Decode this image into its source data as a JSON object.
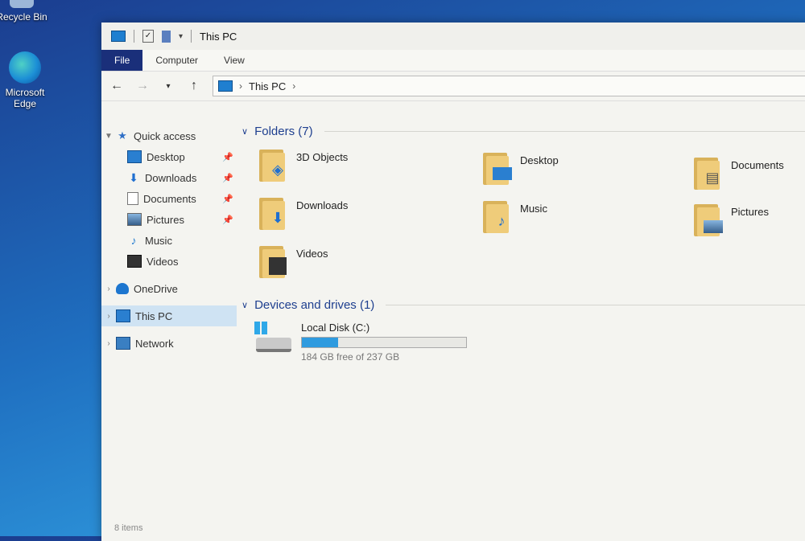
{
  "desktop": {
    "recycle_label": "Recycle Bin",
    "edge_label": "Microsoft Edge"
  },
  "window": {
    "title": "This PC"
  },
  "ribbon": {
    "tabs": [
      "File",
      "Computer",
      "View"
    ]
  },
  "address": {
    "crumb": "This PC"
  },
  "nav": {
    "quick_access": "Quick access",
    "items": [
      "Desktop",
      "Downloads",
      "Documents",
      "Pictures",
      "Music",
      "Videos"
    ],
    "onedrive": "OneDrive",
    "this_pc": "This PC",
    "network": "Network"
  },
  "main": {
    "folders_header": "Folders (7)",
    "folders": [
      {
        "label": "3D Objects",
        "icon": "cube-icon"
      },
      {
        "label": "Desktop",
        "icon": "monitor-icon"
      },
      {
        "label": "Documents",
        "icon": "document-icon"
      },
      {
        "label": "Downloads",
        "icon": "down-arrow-icon"
      },
      {
        "label": "Music",
        "icon": "music-note-icon"
      },
      {
        "label": "Pictures",
        "icon": "picture-icon"
      },
      {
        "label": "Videos",
        "icon": "film-icon"
      }
    ],
    "drives_header": "Devices and drives (1)",
    "drive": {
      "name": "Local Disk (C:)",
      "free_text": "184 GB free of 237 GB",
      "used_fraction": 0.22
    }
  },
  "status": {
    "items": "8 items"
  },
  "colors": {
    "accent": "#1e3f8f",
    "file_tab": "#1a2f7a",
    "selection": "#cfe3f3",
    "folder": "#efcc7a"
  }
}
